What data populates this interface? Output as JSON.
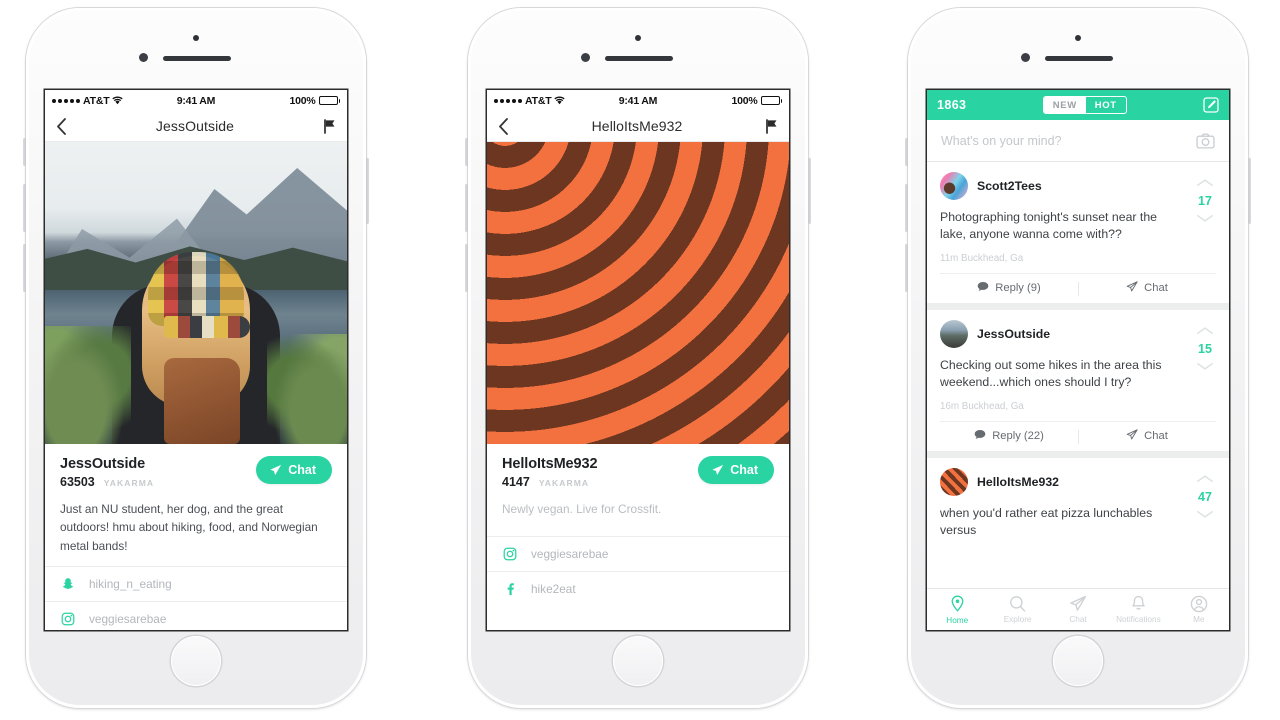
{
  "status_bar": {
    "carrier": "AT&T",
    "time": "9:41 AM",
    "battery": "100%"
  },
  "phone1": {
    "nav": {
      "title": "JessOutside",
      "back_icon": "chevron-left-icon",
      "flag_icon": "flag-icon"
    },
    "photo_alt": "woman in plaid cap facing mountain lake",
    "profile": {
      "username": "JessOutside",
      "karma": "63503",
      "karma_label": "YAKARMA",
      "chat_label": "Chat",
      "bio": "Just an NU student, her dog, and the great outdoors! hmu about hiking, food, and Norwegian metal bands!",
      "socials": [
        {
          "icon": "snapchat-icon",
          "handle": "hiking_n_eating"
        },
        {
          "icon": "instagram-icon",
          "handle": "veggiesarebae"
        }
      ]
    }
  },
  "phone2": {
    "nav": {
      "title": "HelloItsMe932",
      "back_icon": "chevron-left-icon",
      "flag_icon": "flag-icon"
    },
    "photo_alt": "orange and brown concentric arc pattern",
    "profile": {
      "username": "HelloItsMe932",
      "karma": "4147",
      "karma_label": "YAKARMA",
      "chat_label": "Chat",
      "bio": "Newly vegan. Live for Crossfit.",
      "socials": [
        {
          "icon": "instagram-icon",
          "handle": "veggiesarebae"
        },
        {
          "icon": "facebook-icon",
          "handle": "hike2eat"
        }
      ]
    }
  },
  "phone3": {
    "header": {
      "karma": "1863",
      "tabs": [
        {
          "label": "NEW",
          "selected": true
        },
        {
          "label": "HOT",
          "selected": false
        }
      ],
      "compose_icon": "compose-icon"
    },
    "composer": {
      "placeholder": "What's on your mind?",
      "camera_icon": "camera-icon"
    },
    "posts": [
      {
        "user": "Scott2Tees",
        "text": "Photographing tonight's sunset near the lake, anyone wanna come with??",
        "meta": "11m Buckhead, Ga",
        "votes": "17",
        "reply_label": "Reply (9)",
        "chat_label": "Chat"
      },
      {
        "user": "JessOutside",
        "text": "Checking out some hikes in the area this weekend...which ones should I try?",
        "meta": "16m Buckhead, Ga",
        "votes": "15",
        "reply_label": "Reply (22)",
        "chat_label": "Chat"
      },
      {
        "user": "HelloItsMe932",
        "text": "when you'd rather eat pizza lunchables versus",
        "meta": "",
        "votes": "47",
        "reply_label": "",
        "chat_label": ""
      }
    ],
    "tabbar": [
      {
        "label": "Home",
        "icon": "location-pin-icon",
        "active": true
      },
      {
        "label": "Explore",
        "icon": "search-icon",
        "active": false
      },
      {
        "label": "Chat",
        "icon": "paper-plane-icon",
        "active": false
      },
      {
        "label": "Notifications",
        "icon": "bell-icon",
        "active": false
      },
      {
        "label": "Me",
        "icon": "person-circle-icon",
        "active": false
      }
    ]
  },
  "colors": {
    "accent": "#2ad3a2",
    "arc_orange": "#f3713f",
    "arc_brown": "#6d3620"
  }
}
